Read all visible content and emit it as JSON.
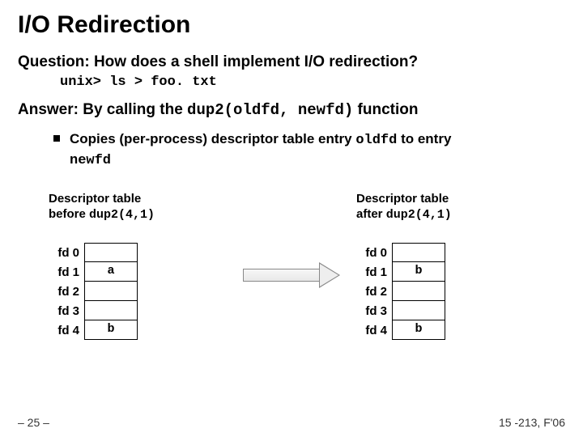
{
  "title": "I/O Redirection",
  "question": "Question: How does a shell implement I/O redirection?",
  "command": "unix> ls > foo. txt",
  "answer_prefix": "Answer: By calling the ",
  "answer_code": "dup2(oldfd, newfd)",
  "answer_suffix": " function",
  "bullet_p1": "Copies (per-process) descriptor table entry ",
  "bullet_c1": "oldfd",
  "bullet_p2": " to entry ",
  "bullet_c2": "newfd",
  "before_caption_line1": "Descriptor table",
  "before_caption_line2a": "before ",
  "before_caption_line2b": "dup2(4,1)",
  "after_caption_line1": "Descriptor table",
  "after_caption_line2a": "after ",
  "after_caption_line2b": "dup2(4,1)",
  "rows": {
    "r0": "fd 0",
    "r1": "fd 1",
    "r2": "fd 2",
    "r3": "fd 3",
    "r4": "fd 4"
  },
  "before_vals": {
    "v0": "",
    "v1": "a",
    "v2": "",
    "v3": "",
    "v4": "b"
  },
  "after_vals": {
    "v0": "",
    "v1": "b",
    "v2": "",
    "v3": "",
    "v4": "b"
  },
  "footer_left": "– 25 –",
  "footer_right": "15 -213, F'06"
}
